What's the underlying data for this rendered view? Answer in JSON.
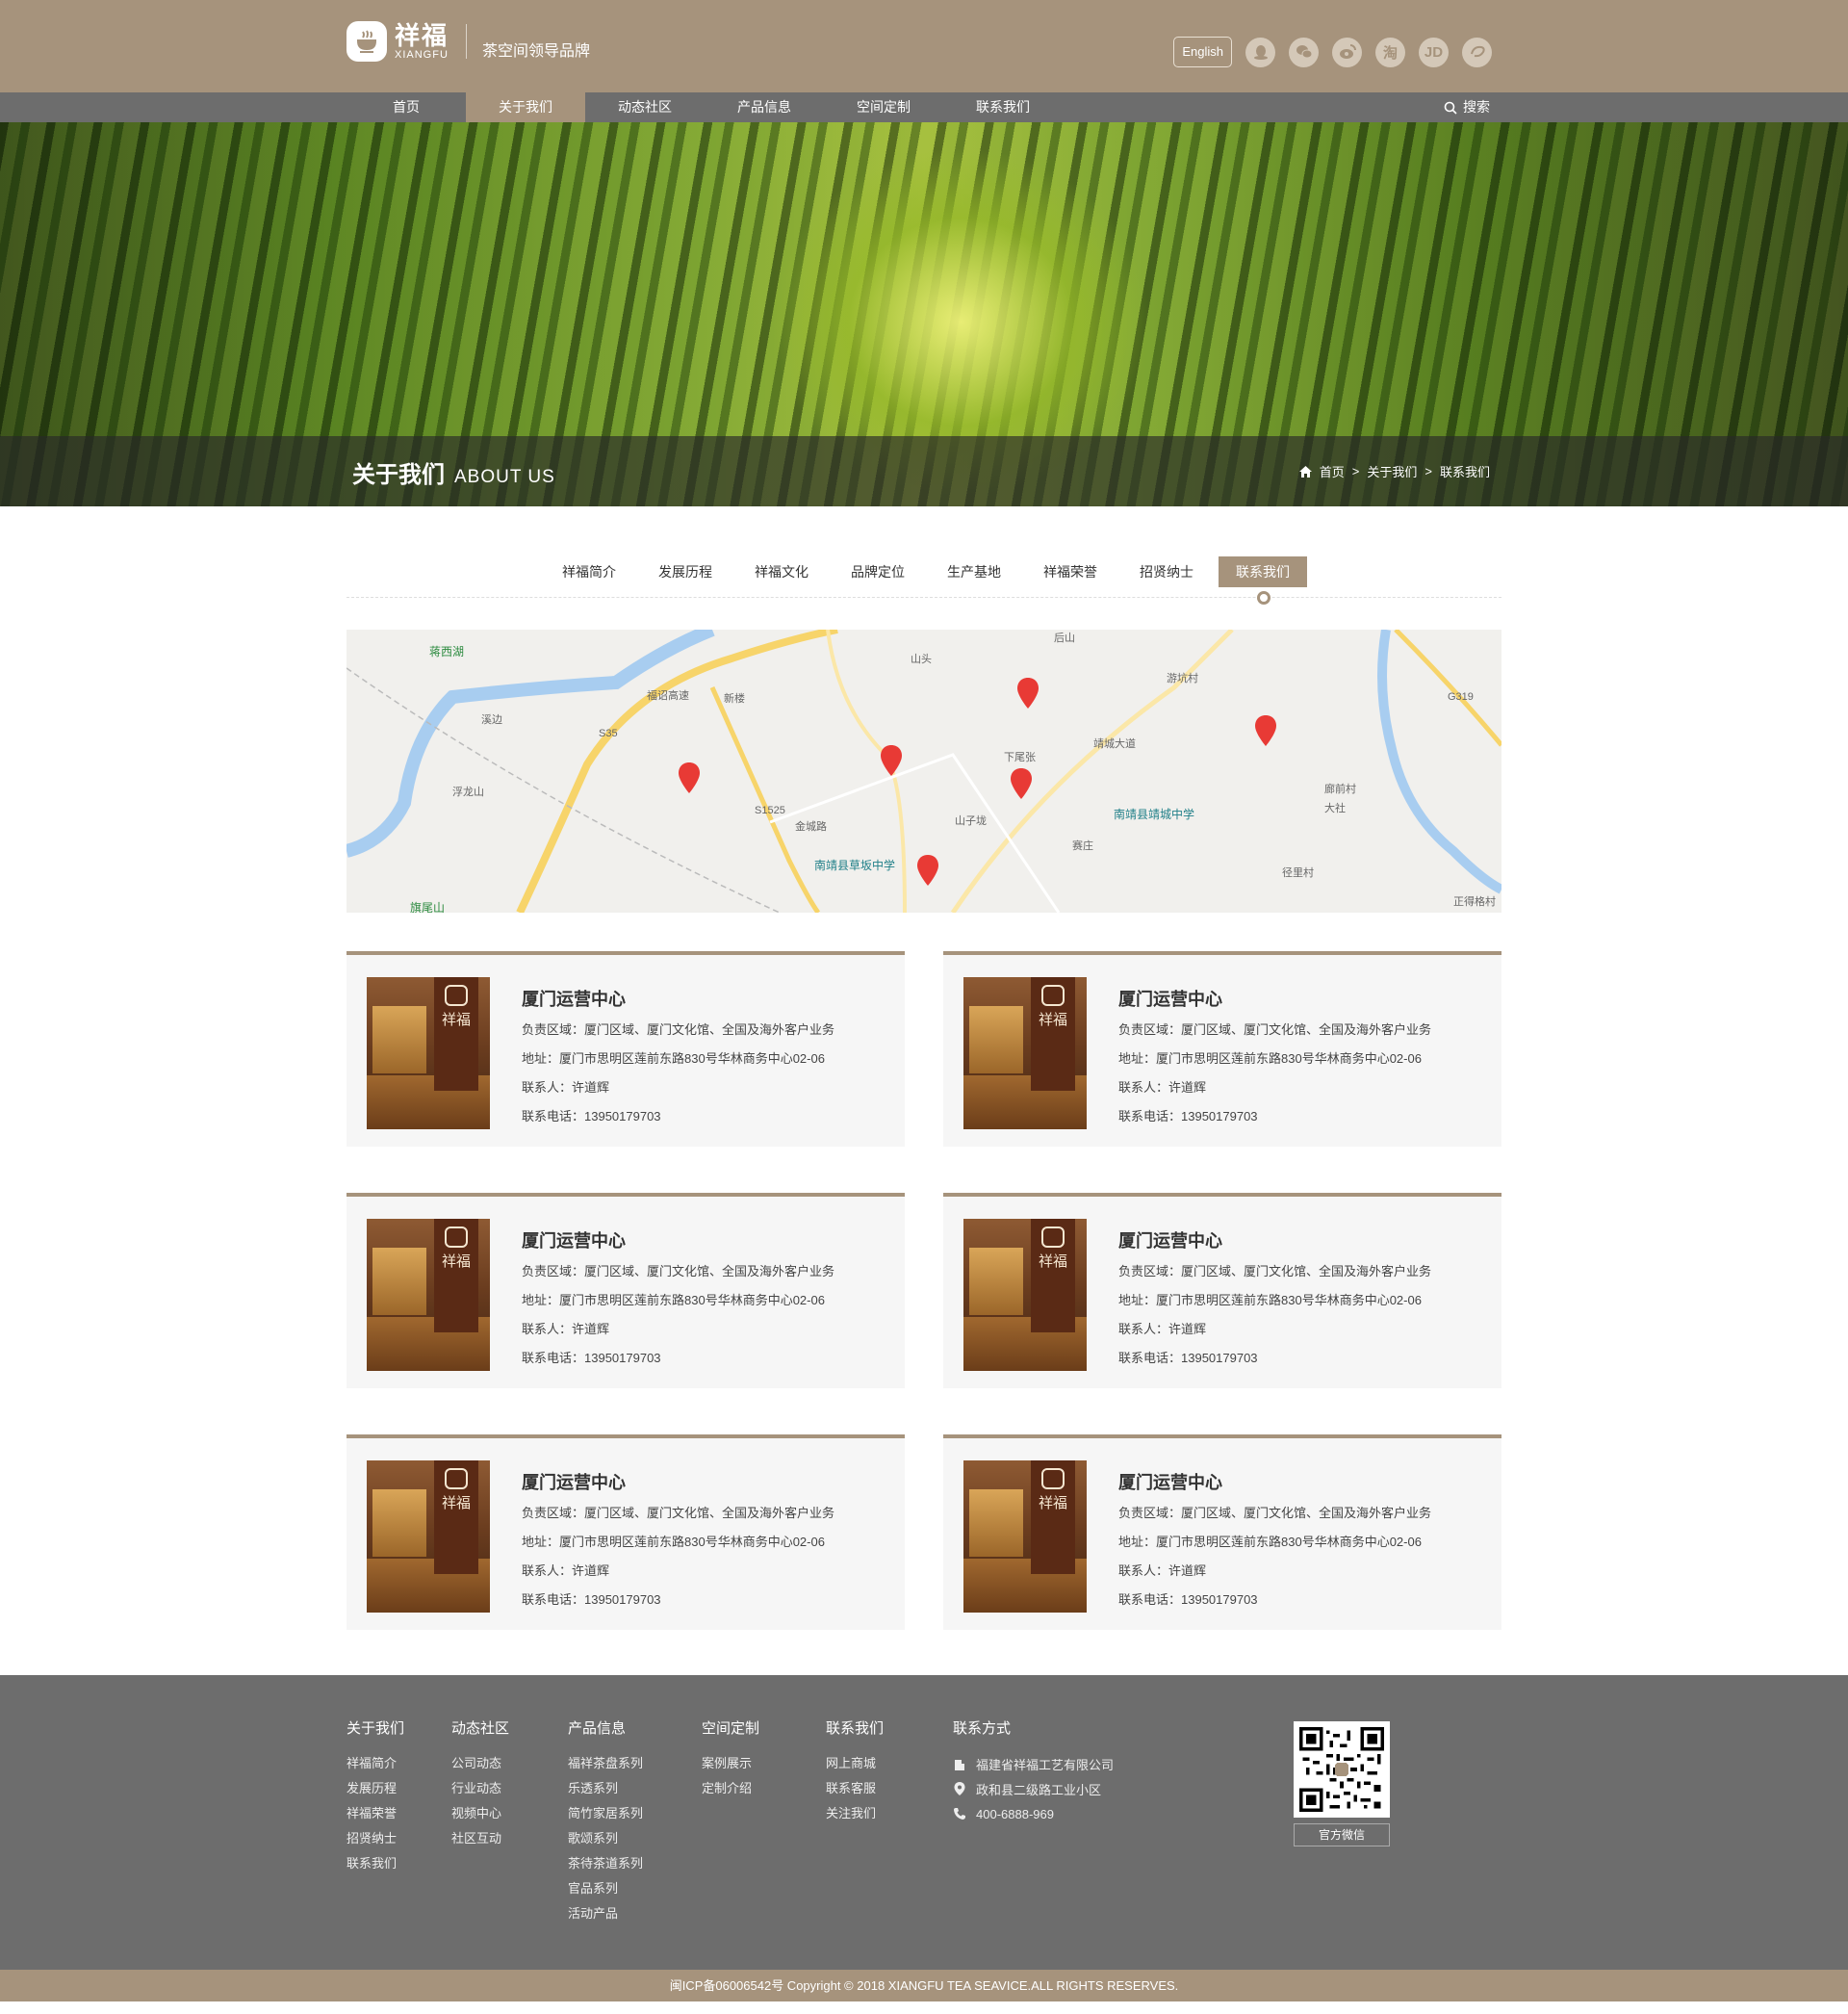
{
  "header": {
    "brand_cn": "祥福",
    "brand_en": "XIANGFU",
    "slogan": "茶空间领导品牌",
    "lang_button": "English",
    "social_icons": [
      "qq-icon",
      "wechat-icon",
      "weibo-icon",
      "taobao-icon",
      "jd-icon",
      "mall-icon"
    ],
    "taobao_glyph": "淘",
    "jd_glyph": "JD"
  },
  "nav": {
    "items": [
      "首页",
      "关于我们",
      "动态社区",
      "产品信息",
      "空间定制",
      "联系我们"
    ],
    "active": "关于我们",
    "search_label": "搜索"
  },
  "banner": {
    "title_cn": "关于我们",
    "title_en": "ABOUT US",
    "breadcrumb": [
      "首页",
      "关于我们",
      "联系我们"
    ],
    "sep": ">"
  },
  "subnav": {
    "items": [
      "祥福简介",
      "发展历程",
      "祥福文化",
      "品牌定位",
      "生产基地",
      "祥福荣誉",
      "招贤纳士",
      "联系我们"
    ],
    "active": "联系我们"
  },
  "map": {
    "labels": [
      "蒋西湖",
      "溪边",
      "浮龙山",
      "旗尾山",
      "新楼",
      "山头",
      "后山",
      "游坑村",
      "下尾张",
      "山子垅",
      "赛庄",
      "南靖县靖城中学",
      "南靖县草坂中学",
      "廊前村",
      "大社",
      "径里村",
      "正得格村",
      "福诏高速",
      "金城路",
      "靖城大道",
      "S35",
      "S1525",
      "G319"
    ]
  },
  "cards": [
    {
      "title": "厦门运营中心",
      "area": "负责区域：厦门区域、厦门文化馆、全国及海外客户业务",
      "address": "地址：厦门市思明区莲前东路830号华林商务中心02-06",
      "contact": "联系人：许道辉",
      "phone": "联系电话：13950179703",
      "img_text": "祥福"
    },
    {
      "title": "厦门运营中心",
      "area": "负责区域：厦门区域、厦门文化馆、全国及海外客户业务",
      "address": "地址：厦门市思明区莲前东路830号华林商务中心02-06",
      "contact": "联系人：许道辉",
      "phone": "联系电话：13950179703",
      "img_text": "祥福"
    },
    {
      "title": "厦门运营中心",
      "area": "负责区域：厦门区域、厦门文化馆、全国及海外客户业务",
      "address": "地址：厦门市思明区莲前东路830号华林商务中心02-06",
      "contact": "联系人：许道辉",
      "phone": "联系电话：13950179703",
      "img_text": "祥福"
    },
    {
      "title": "厦门运营中心",
      "area": "负责区域：厦门区域、厦门文化馆、全国及海外客户业务",
      "address": "地址：厦门市思明区莲前东路830号华林商务中心02-06",
      "contact": "联系人：许道辉",
      "phone": "联系电话：13950179703",
      "img_text": "祥福"
    },
    {
      "title": "厦门运营中心",
      "area": "负责区域：厦门区域、厦门文化馆、全国及海外客户业务",
      "address": "地址：厦门市思明区莲前东路830号华林商务中心02-06",
      "contact": "联系人：许道辉",
      "phone": "联系电话：13950179703",
      "img_text": "祥福"
    },
    {
      "title": "厦门运营中心",
      "area": "负责区域：厦门区域、厦门文化馆、全国及海外客户业务",
      "address": "地址：厦门市思明区莲前东路830号华林商务中心02-06",
      "contact": "联系人：许道辉",
      "phone": "联系电话：13950179703",
      "img_text": "祥福"
    }
  ],
  "footer": {
    "columns": [
      {
        "heading": "关于我们",
        "links": [
          "祥福简介",
          "发展历程",
          "祥福荣誉",
          "招贤纳士",
          "联系我们"
        ]
      },
      {
        "heading": "动态社区",
        "links": [
          "公司动态",
          "行业动态",
          "视频中心",
          "社区互动"
        ]
      },
      {
        "heading": "产品信息",
        "links": [
          "福祥茶盘系列",
          "乐透系列",
          "简竹家居系列",
          "歌颂系列",
          "茶待茶道系列",
          "官品系列",
          "活动产品"
        ]
      },
      {
        "heading": "空间定制",
        "links": [
          "案例展示",
          "定制介绍"
        ]
      },
      {
        "heading": "联系我们",
        "links": [
          "网上商城",
          "联系客服",
          "关注我们"
        ]
      }
    ],
    "contact_heading": "联系方式",
    "contact": [
      "福建省祥福工艺有限公司",
      "政和县二级路工业小区",
      "400-6888-969"
    ],
    "qr_label": "官方微信",
    "copyright": "闽ICP备06006542号 Copyright © 2018 XIANGFU TEA SEAVICE.ALL RIGHTS RESERVES."
  },
  "colors": {
    "brand": "#a6937c",
    "nav": "#6d6d6d",
    "pin": "#e83a35"
  }
}
